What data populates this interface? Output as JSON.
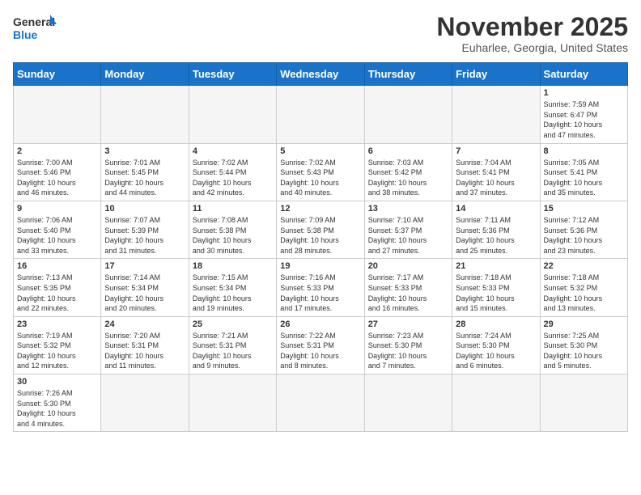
{
  "header": {
    "logo_general": "General",
    "logo_blue": "Blue",
    "month_title": "November 2025",
    "location": "Euharlee, Georgia, United States"
  },
  "weekdays": [
    "Sunday",
    "Monday",
    "Tuesday",
    "Wednesday",
    "Thursday",
    "Friday",
    "Saturday"
  ],
  "weeks": [
    [
      {
        "day": "",
        "info": ""
      },
      {
        "day": "",
        "info": ""
      },
      {
        "day": "",
        "info": ""
      },
      {
        "day": "",
        "info": ""
      },
      {
        "day": "",
        "info": ""
      },
      {
        "day": "",
        "info": ""
      },
      {
        "day": "1",
        "info": "Sunrise: 7:59 AM\nSunset: 6:47 PM\nDaylight: 10 hours\nand 47 minutes."
      }
    ],
    [
      {
        "day": "2",
        "info": "Sunrise: 7:00 AM\nSunset: 5:46 PM\nDaylight: 10 hours\nand 46 minutes."
      },
      {
        "day": "3",
        "info": "Sunrise: 7:01 AM\nSunset: 5:45 PM\nDaylight: 10 hours\nand 44 minutes."
      },
      {
        "day": "4",
        "info": "Sunrise: 7:02 AM\nSunset: 5:44 PM\nDaylight: 10 hours\nand 42 minutes."
      },
      {
        "day": "5",
        "info": "Sunrise: 7:02 AM\nSunset: 5:43 PM\nDaylight: 10 hours\nand 40 minutes."
      },
      {
        "day": "6",
        "info": "Sunrise: 7:03 AM\nSunset: 5:42 PM\nDaylight: 10 hours\nand 38 minutes."
      },
      {
        "day": "7",
        "info": "Sunrise: 7:04 AM\nSunset: 5:41 PM\nDaylight: 10 hours\nand 37 minutes."
      },
      {
        "day": "8",
        "info": "Sunrise: 7:05 AM\nSunset: 5:41 PM\nDaylight: 10 hours\nand 35 minutes."
      }
    ],
    [
      {
        "day": "9",
        "info": "Sunrise: 7:06 AM\nSunset: 5:40 PM\nDaylight: 10 hours\nand 33 minutes."
      },
      {
        "day": "10",
        "info": "Sunrise: 7:07 AM\nSunset: 5:39 PM\nDaylight: 10 hours\nand 31 minutes."
      },
      {
        "day": "11",
        "info": "Sunrise: 7:08 AM\nSunset: 5:38 PM\nDaylight: 10 hours\nand 30 minutes."
      },
      {
        "day": "12",
        "info": "Sunrise: 7:09 AM\nSunset: 5:38 PM\nDaylight: 10 hours\nand 28 minutes."
      },
      {
        "day": "13",
        "info": "Sunrise: 7:10 AM\nSunset: 5:37 PM\nDaylight: 10 hours\nand 27 minutes."
      },
      {
        "day": "14",
        "info": "Sunrise: 7:11 AM\nSunset: 5:36 PM\nDaylight: 10 hours\nand 25 minutes."
      },
      {
        "day": "15",
        "info": "Sunrise: 7:12 AM\nSunset: 5:36 PM\nDaylight: 10 hours\nand 23 minutes."
      }
    ],
    [
      {
        "day": "16",
        "info": "Sunrise: 7:13 AM\nSunset: 5:35 PM\nDaylight: 10 hours\nand 22 minutes."
      },
      {
        "day": "17",
        "info": "Sunrise: 7:14 AM\nSunset: 5:34 PM\nDaylight: 10 hours\nand 20 minutes."
      },
      {
        "day": "18",
        "info": "Sunrise: 7:15 AM\nSunset: 5:34 PM\nDaylight: 10 hours\nand 19 minutes."
      },
      {
        "day": "19",
        "info": "Sunrise: 7:16 AM\nSunset: 5:33 PM\nDaylight: 10 hours\nand 17 minutes."
      },
      {
        "day": "20",
        "info": "Sunrise: 7:17 AM\nSunset: 5:33 PM\nDaylight: 10 hours\nand 16 minutes."
      },
      {
        "day": "21",
        "info": "Sunrise: 7:18 AM\nSunset: 5:33 PM\nDaylight: 10 hours\nand 15 minutes."
      },
      {
        "day": "22",
        "info": "Sunrise: 7:18 AM\nSunset: 5:32 PM\nDaylight: 10 hours\nand 13 minutes."
      }
    ],
    [
      {
        "day": "23",
        "info": "Sunrise: 7:19 AM\nSunset: 5:32 PM\nDaylight: 10 hours\nand 12 minutes."
      },
      {
        "day": "24",
        "info": "Sunrise: 7:20 AM\nSunset: 5:31 PM\nDaylight: 10 hours\nand 11 minutes."
      },
      {
        "day": "25",
        "info": "Sunrise: 7:21 AM\nSunset: 5:31 PM\nDaylight: 10 hours\nand 9 minutes."
      },
      {
        "day": "26",
        "info": "Sunrise: 7:22 AM\nSunset: 5:31 PM\nDaylight: 10 hours\nand 8 minutes."
      },
      {
        "day": "27",
        "info": "Sunrise: 7:23 AM\nSunset: 5:30 PM\nDaylight: 10 hours\nand 7 minutes."
      },
      {
        "day": "28",
        "info": "Sunrise: 7:24 AM\nSunset: 5:30 PM\nDaylight: 10 hours\nand 6 minutes."
      },
      {
        "day": "29",
        "info": "Sunrise: 7:25 AM\nSunset: 5:30 PM\nDaylight: 10 hours\nand 5 minutes."
      }
    ],
    [
      {
        "day": "30",
        "info": "Sunrise: 7:26 AM\nSunset: 5:30 PM\nDaylight: 10 hours\nand 4 minutes."
      },
      {
        "day": "",
        "info": ""
      },
      {
        "day": "",
        "info": ""
      },
      {
        "day": "",
        "info": ""
      },
      {
        "day": "",
        "info": ""
      },
      {
        "day": "",
        "info": ""
      },
      {
        "day": "",
        "info": ""
      }
    ]
  ]
}
